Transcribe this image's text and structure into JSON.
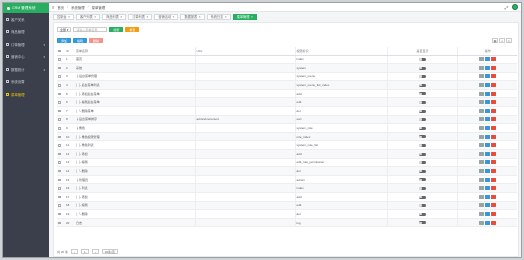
{
  "sidebar": {
    "brand": "CRM 管理系统",
    "items": [
      {
        "label": "客户关系",
        "icon": "user-icon",
        "chevron": false,
        "active": false
      },
      {
        "label": "商品管理",
        "icon": "box-icon",
        "chevron": false,
        "active": false
      },
      {
        "label": "订单管理",
        "icon": "cart-icon",
        "chevron": true,
        "active": false
      },
      {
        "label": "营销中心",
        "icon": "megaphone-icon",
        "chevron": true,
        "active": false
      },
      {
        "label": "数据统计",
        "icon": "chart-icon",
        "chevron": true,
        "active": false
      },
      {
        "label": "系统设置",
        "icon": "gear-icon",
        "chevron": false,
        "active": false
      },
      {
        "label": "菜单管理",
        "icon": "menu-icon",
        "chevron": false,
        "active": true
      }
    ]
  },
  "topbar": {
    "home": "首页",
    "crumb1": "系统管理",
    "crumb2": "菜单管理"
  },
  "tabs": [
    "控制台",
    "客户列表",
    "商品列表",
    "订单列表",
    "营销活动",
    "数据报表",
    "系统日志",
    "菜单管理"
  ],
  "toolbar": {
    "select_value": "全部",
    "search_placeholder": "请输入菜单名称",
    "search_btn": "搜索",
    "reset_btn": "重置",
    "add_btn": "添加",
    "edit_btn": "编辑",
    "delete_btn": "删除"
  },
  "table": {
    "headers": [
      "ID",
      "菜单名称",
      "URL",
      "权限标识",
      "是否显示",
      "操作"
    ],
    "rows": [
      {
        "id": "1",
        "name": "首页",
        "url": "",
        "perm": "index"
      },
      {
        "id": "2",
        "name": "系统",
        "url": "",
        "perm": "system"
      },
      {
        "id": "3",
        "name": "├ 后台菜单管理",
        "url": "",
        "perm": "system_menu"
      },
      {
        "id": "4",
        "name": "│ ├ 后台菜单列表",
        "url": "",
        "perm": "system_menu_list_index"
      },
      {
        "id": "5",
        "name": "│ ├ 添加后台菜单",
        "url": "",
        "perm": "add"
      },
      {
        "id": "6",
        "name": "│ ├ 编辑后台菜单",
        "url": "",
        "perm": "edit"
      },
      {
        "id": "7",
        "name": "│ └ 删除菜单",
        "url": "",
        "perm": "del"
      },
      {
        "id": "8",
        "name": "├ 后台菜单排序",
        "url": "admin/menu/sort",
        "perm": "sort"
      },
      {
        "id": "9",
        "name": "├ 角色",
        "url": "",
        "perm": "system_role"
      },
      {
        "id": "10",
        "name": "│ ├ 角色权限管理",
        "url": "",
        "perm": "role_index"
      },
      {
        "id": "11",
        "name": "│ ├ 角色列表",
        "url": "",
        "perm": "system_role_list"
      },
      {
        "id": "12",
        "name": "│ ├ 添加",
        "url": "",
        "perm": "add"
      },
      {
        "id": "13",
        "name": "│ ├ 编辑",
        "url": "",
        "perm": "edit_role_permission"
      },
      {
        "id": "14",
        "name": "│ └ 删除",
        "url": "",
        "perm": "del"
      },
      {
        "id": "15",
        "name": "├ 管理员",
        "url": "",
        "perm": "admin"
      },
      {
        "id": "16",
        "name": "│ ├ 列表",
        "url": "",
        "perm": "index"
      },
      {
        "id": "17",
        "name": "│ ├ 添加",
        "url": "",
        "perm": "add"
      },
      {
        "id": "18",
        "name": "│ ├ 编辑",
        "url": "",
        "perm": "edit"
      },
      {
        "id": "19",
        "name": "│ └ 删除",
        "url": "",
        "perm": "del"
      },
      {
        "id": "20",
        "name": "日志",
        "url": "",
        "perm": "log"
      }
    ]
  },
  "footer": {
    "total": "共 20 条",
    "page": "1",
    "per_page": "20条/页"
  },
  "colors": {
    "accent": "#27ae60",
    "sidebar_bg": "#3a3f4b",
    "blue": "#3498db",
    "red": "#e74c3c",
    "orange": "#f39c12"
  }
}
